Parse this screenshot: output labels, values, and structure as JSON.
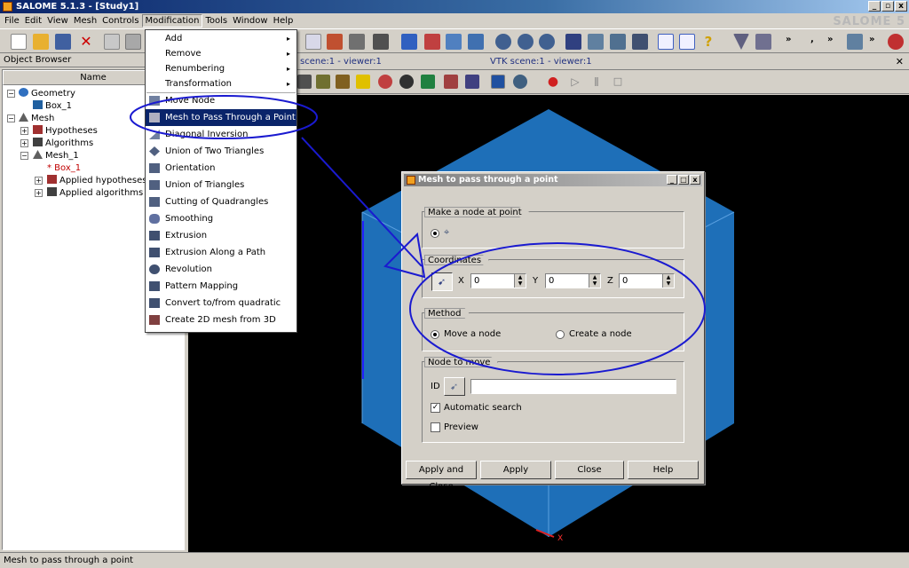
{
  "window": {
    "title": "SALOME 5.1.3 - [Study1]",
    "brand": "SALOME 5"
  },
  "menubar": [
    "File",
    "Edit",
    "View",
    "Mesh",
    "Controls",
    "Modification",
    "Tools",
    "Window",
    "Help"
  ],
  "object_browser": {
    "title": "Object Browser",
    "column_header": "Name",
    "tree": [
      "Geometry",
      "Box_1",
      "Mesh",
      "Hypotheses",
      "Algorithms",
      "Mesh_1",
      "* Box_1",
      "Applied hypotheses",
      "Applied algorithms"
    ]
  },
  "viewer": {
    "tab1": "scene:1 - viewer:1",
    "tab2": "VTK scene:1 - viewer:1",
    "axis_label": "X",
    "colors": {
      "box_face": "#1e6fb8",
      "box_edge": "#5aa0e0",
      "background": "#000000"
    }
  },
  "modification_menu": {
    "items": [
      {
        "label": "Add",
        "submenu": true
      },
      {
        "label": "Remove",
        "submenu": true
      },
      {
        "label": "Renumbering",
        "submenu": true
      },
      {
        "label": "Transformation",
        "submenu": true
      },
      {
        "label": "Move Node"
      },
      {
        "label": "Mesh to Pass Through a Point",
        "selected": true
      },
      {
        "label": "Diagonal Inversion"
      },
      {
        "label": "Union of Two Triangles"
      },
      {
        "label": "Orientation"
      },
      {
        "label": "Union of Triangles"
      },
      {
        "label": "Cutting of Quadrangles"
      },
      {
        "label": "Smoothing"
      },
      {
        "label": "Extrusion"
      },
      {
        "label": "Extrusion Along a Path"
      },
      {
        "label": "Revolution"
      },
      {
        "label": "Pattern Mapping"
      },
      {
        "label": "Convert to/from quadratic"
      },
      {
        "label": "Create 2D mesh from 3D"
      }
    ],
    "submenu_arrow": "▸"
  },
  "dialog": {
    "title": "Mesh to pass through a point",
    "make_node_group": "Make a node at point",
    "coordinates_group": "Coordinates",
    "x_label": "X",
    "y_label": "Y",
    "z_label": "Z",
    "x_value": "0",
    "y_value": "0",
    "z_value": "0",
    "method_group": "Method",
    "method_move": "Move a node",
    "method_create": "Create a node",
    "node_to_move_group": "Node to move",
    "id_label": "ID",
    "id_value": "",
    "automatic_search": "Automatic search",
    "preview": "Preview",
    "buttons": {
      "apply_close": "Apply and Close",
      "apply": "Apply",
      "close": "Close",
      "help": "Help"
    }
  },
  "statusbar": {
    "text": "Mesh to pass through a point"
  },
  "annotation_color": "#1a1ad0"
}
